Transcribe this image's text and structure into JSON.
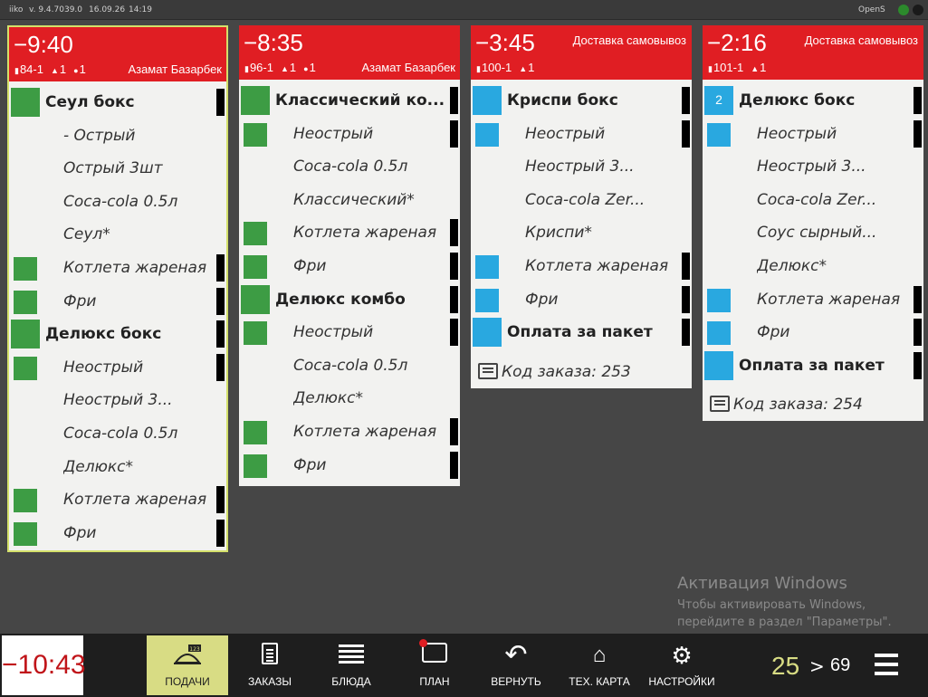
{
  "topbar": {
    "app_name": "iiko",
    "version": "v. 9.4.7039.0",
    "date": "16.09.26",
    "time": "14:19",
    "terminal": "OpenS"
  },
  "orders": [
    {
      "timer": "−9:40",
      "service": "",
      "table": "84-1",
      "guests": "1",
      "seats": "1",
      "waiter": "Азамат Базарбек",
      "selected": true,
      "items": [
        {
          "kind": "main",
          "text": "Сеул бокс",
          "square": "green",
          "bar": true
        },
        {
          "kind": "mod",
          "text": "- Острый",
          "square": "",
          "bar": false
        },
        {
          "kind": "mod",
          "text": "Острый 3шт",
          "square": "",
          "bar": false
        },
        {
          "kind": "mod",
          "text": "Coca-cola 0.5л",
          "square": "",
          "bar": false
        },
        {
          "kind": "mod",
          "text": "Сеул*",
          "square": "",
          "bar": false
        },
        {
          "kind": "mod",
          "text": "Котлета жареная",
          "square": "green",
          "bar": true
        },
        {
          "kind": "mod",
          "text": "Фри",
          "square": "green",
          "bar": true
        },
        {
          "kind": "main",
          "text": "Делюкс бокс",
          "square": "green",
          "bar": true
        },
        {
          "kind": "mod",
          "text": "Неострый",
          "square": "green",
          "bar": true
        },
        {
          "kind": "mod",
          "text": "Неострый 3...",
          "square": "",
          "bar": false
        },
        {
          "kind": "mod",
          "text": "Coca-cola 0.5л",
          "square": "",
          "bar": false
        },
        {
          "kind": "mod",
          "text": "Делюкс*",
          "square": "",
          "bar": false
        },
        {
          "kind": "mod",
          "text": "Котлета жареная",
          "square": "green",
          "bar": true
        },
        {
          "kind": "mod",
          "text": "Фри",
          "square": "green",
          "bar": true
        }
      ],
      "order_code": ""
    },
    {
      "timer": "−8:35",
      "service": "",
      "table": "96-1",
      "guests": "1",
      "seats": "1",
      "waiter": "Азамат Базарбек",
      "selected": false,
      "items": [
        {
          "kind": "main",
          "text": "Классический ко...",
          "square": "green",
          "bar": true
        },
        {
          "kind": "mod",
          "text": "Неострый",
          "square": "green",
          "bar": true
        },
        {
          "kind": "mod",
          "text": "Coca-cola 0.5л",
          "square": "",
          "bar": false
        },
        {
          "kind": "mod",
          "text": "Классический*",
          "square": "",
          "bar": false
        },
        {
          "kind": "mod",
          "text": "Котлета жареная",
          "square": "green",
          "bar": true
        },
        {
          "kind": "mod",
          "text": "Фри",
          "square": "green",
          "bar": true
        },
        {
          "kind": "main",
          "text": "Делюкс комбо",
          "square": "green",
          "bar": true
        },
        {
          "kind": "mod",
          "text": "Неострый",
          "square": "green",
          "bar": true
        },
        {
          "kind": "mod",
          "text": "Coca-cola 0.5л",
          "square": "",
          "bar": false
        },
        {
          "kind": "mod",
          "text": "Делюкс*",
          "square": "",
          "bar": false
        },
        {
          "kind": "mod",
          "text": "Котлета жареная",
          "square": "green",
          "bar": true
        },
        {
          "kind": "mod",
          "text": "Фри",
          "square": "green",
          "bar": true
        }
      ],
      "order_code": ""
    },
    {
      "timer": "−3:45",
      "service": "Доставка самовывоз",
      "table": "100-1",
      "guests": "1",
      "seats": "",
      "waiter": "",
      "selected": false,
      "items": [
        {
          "kind": "main",
          "text": "Криспи бокс",
          "square": "blue",
          "bar": true
        },
        {
          "kind": "mod",
          "text": "Неострый",
          "square": "blue",
          "bar": true
        },
        {
          "kind": "mod",
          "text": "Неострый 3...",
          "square": "",
          "bar": false
        },
        {
          "kind": "mod",
          "text": "Coca-cola Zer...",
          "square": "",
          "bar": false
        },
        {
          "kind": "mod",
          "text": "Криспи*",
          "square": "",
          "bar": false
        },
        {
          "kind": "mod",
          "text": "Котлета жареная",
          "square": "blue",
          "bar": true
        },
        {
          "kind": "mod",
          "text": "Фри",
          "square": "blue",
          "bar": true
        },
        {
          "kind": "main",
          "text": "Оплата за пакет",
          "square": "blue",
          "bar": true
        }
      ],
      "order_code": "Код заказа: 253"
    },
    {
      "timer": "−2:16",
      "service": "Доставка самовывоз",
      "table": "101-1",
      "guests": "1",
      "seats": "",
      "waiter": "",
      "selected": false,
      "items": [
        {
          "kind": "main",
          "text": "Делюкс бокс",
          "square": "blue",
          "bar": true,
          "count": "2"
        },
        {
          "kind": "mod",
          "text": "Неострый",
          "square": "blue",
          "bar": true
        },
        {
          "kind": "mod",
          "text": "Неострый 3...",
          "square": "",
          "bar": false
        },
        {
          "kind": "mod",
          "text": "Coca-cola Zer...",
          "square": "",
          "bar": false
        },
        {
          "kind": "mod",
          "text": "Соус сырный...",
          "square": "",
          "bar": false
        },
        {
          "kind": "mod",
          "text": "Делюкс*",
          "square": "",
          "bar": false
        },
        {
          "kind": "mod",
          "text": "Котлета жареная",
          "square": "blue",
          "bar": true
        },
        {
          "kind": "mod",
          "text": "Фри",
          "square": "blue",
          "bar": true
        },
        {
          "kind": "main",
          "text": "Оплата за пакет",
          "square": "blue",
          "bar": true
        }
      ],
      "order_code": "Код заказа: 254"
    }
  ],
  "watermark": {
    "title": "Активация Windows",
    "line1": "Чтобы активировать Windows,",
    "line2": "перейдите в раздел \"Параметры\"."
  },
  "bottombar": {
    "clock": "−10:43",
    "nav": [
      {
        "id": "serve",
        "label": "ПОДАЧИ",
        "icon": "serving-dish-icon",
        "active": true
      },
      {
        "id": "orders",
        "label": "ЗАКАЗЫ",
        "icon": "receipt-icon",
        "active": false
      },
      {
        "id": "dishes",
        "label": "БЛЮДА",
        "icon": "list-lines-icon",
        "active": false
      },
      {
        "id": "plan",
        "label": "ПЛАН",
        "icon": "calendar-clock-icon",
        "active": false
      },
      {
        "id": "return",
        "label": "ВЕРНУТЬ",
        "icon": "undo-arrow-icon",
        "active": false
      },
      {
        "id": "techcard",
        "label": "ТЕХ. КАРТА",
        "icon": "chef-hat-icon",
        "active": false
      },
      {
        "id": "settings",
        "label": "НАСТРОЙКИ",
        "icon": "gears-icon",
        "active": false
      }
    ],
    "counter": "25",
    "arrow": ">",
    "total": "69"
  }
}
